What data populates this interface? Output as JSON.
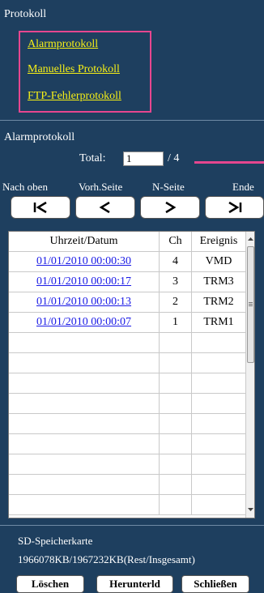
{
  "protokoll": {
    "title": "Protokoll",
    "links": [
      "Alarmprotokoll",
      "Manuelles Protokoll",
      "FTP-Fehlerprotokoll"
    ]
  },
  "log": {
    "title": "Alarmprotokoll",
    "total_label": "Total:",
    "page_value": "1",
    "total_suffix": "/ 4",
    "nav_labels": [
      "Nach oben",
      "Vorh.Seite",
      "N-Seite",
      "Ende"
    ],
    "nav_icons": [
      "first-page-icon",
      "previous-page-icon",
      "next-page-icon",
      "last-page-icon"
    ]
  },
  "table": {
    "headers": [
      "Uhrzeit/Datum",
      "Ch",
      "Ereignis"
    ],
    "rows": [
      {
        "datetime": "01/01/2010 00:00:30",
        "ch": "4",
        "event": "VMD"
      },
      {
        "datetime": "01/01/2010 00:00:17",
        "ch": "3",
        "event": "TRM3"
      },
      {
        "datetime": "01/01/2010 00:00:13",
        "ch": "2",
        "event": "TRM2"
      },
      {
        "datetime": "01/01/2010 00:00:07",
        "ch": "1",
        "event": "TRM1"
      }
    ],
    "empty_rows": 9
  },
  "sd": {
    "title": "SD-Speicherkarte",
    "info": "1966078KB/1967232KB(Rest/Insgesamt)",
    "buttons": [
      "Löschen",
      "Herunterld",
      "Schließen"
    ]
  },
  "colors": {
    "background": "#1e3f5f",
    "highlight": "#e6468f",
    "link": "#f7f016",
    "table_link": "#1a1ae6"
  }
}
